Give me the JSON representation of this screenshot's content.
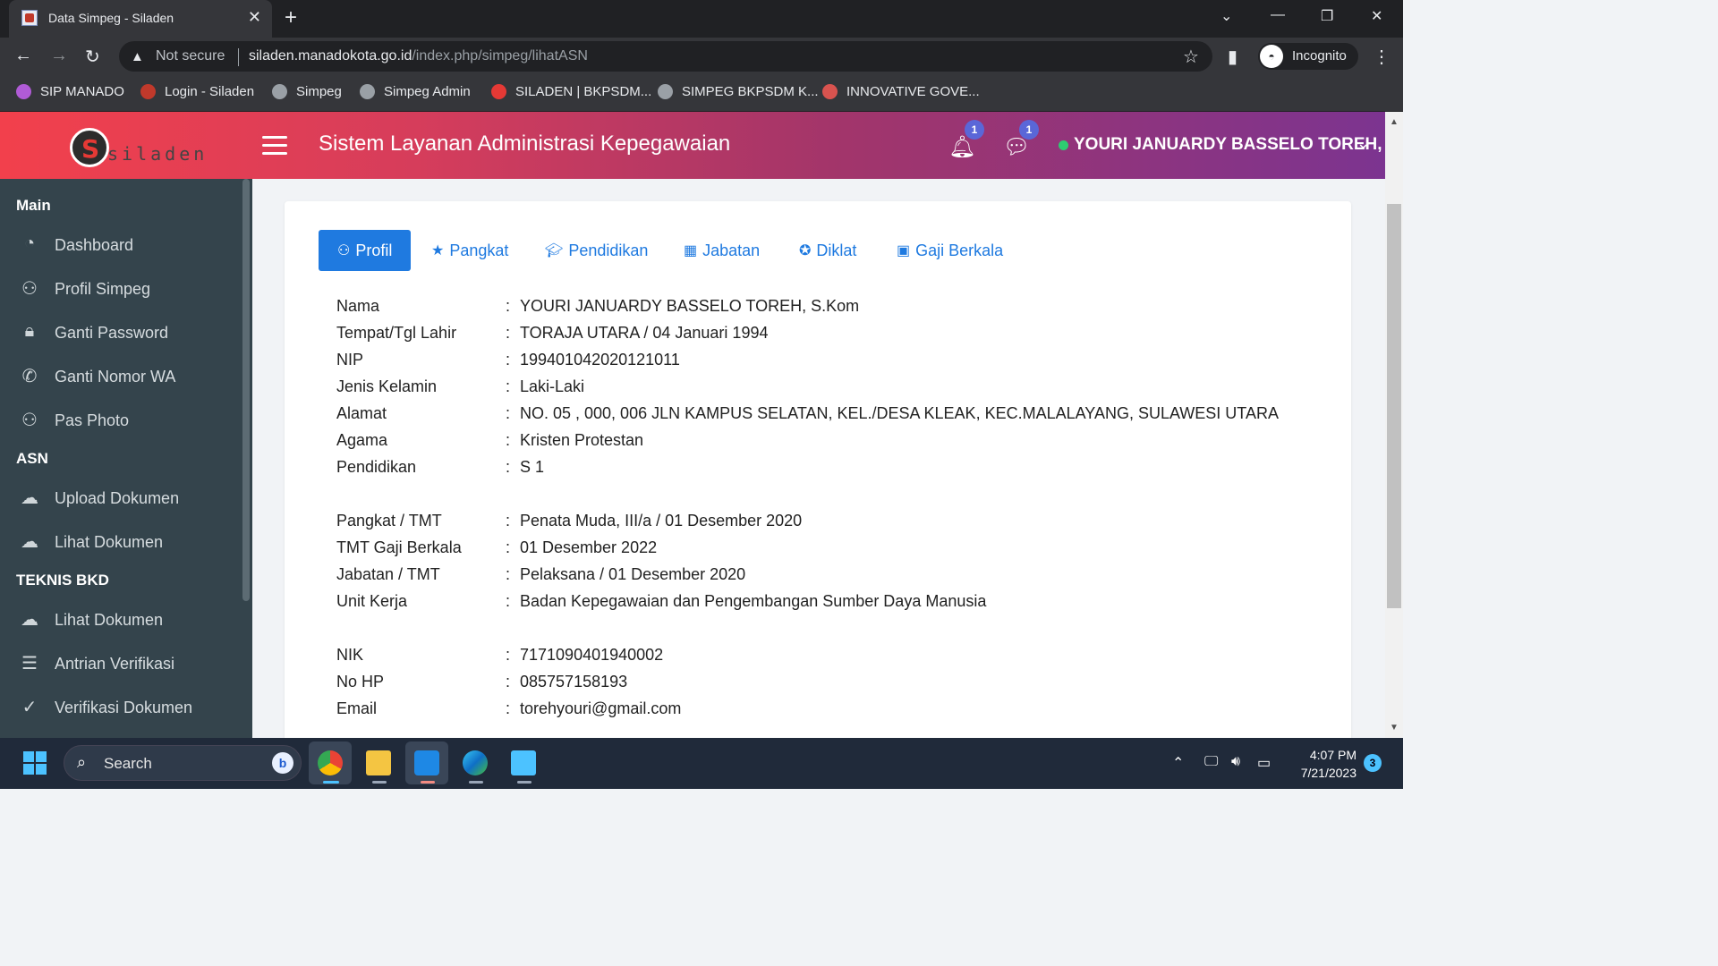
{
  "browser": {
    "tab_title": "Data Simpeg - Siladen",
    "tab_close": "✕",
    "new_tab": "+",
    "address_warning": "Not secure",
    "url_host": "siladen.manadokota.go.id",
    "url_path": "/index.php/simpeg/lihatASN",
    "profile_label": "Incognito",
    "bookmarks": [
      {
        "label": "SIP MANADO",
        "color": "#b05bd6"
      },
      {
        "label": "Login - Siladen",
        "color": "#c0392b"
      },
      {
        "label": "Simpeg",
        "color": "#9aa0a6"
      },
      {
        "label": "Simpeg Admin",
        "color": "#9aa0a6"
      },
      {
        "label": "SILADEN | BKPSDM...",
        "color": "#e53935"
      },
      {
        "label": "SIMPEG BKPSDM K...",
        "color": "#9aa0a6"
      },
      {
        "label": "INNOVATIVE GOVE...",
        "color": "#d9534f"
      }
    ]
  },
  "header": {
    "logo_text": "siladen",
    "title": "Sistem Layanan Administrasi Kepegawaian",
    "notif_count": "1",
    "message_count": "1",
    "user_name": "YOURI JANUARDY BASSELO TOREH,",
    "user_status_color": "#2ecc71"
  },
  "sidebar": {
    "sections": [
      {
        "title": "Main"
      },
      {
        "title": "ASN"
      },
      {
        "title": "TEKNIS BKD"
      }
    ],
    "items": [
      {
        "label": "Dashboard",
        "icon": "dashboard-icon"
      },
      {
        "label": "Profil Simpeg",
        "icon": "user-icon"
      },
      {
        "label": "Ganti Password",
        "icon": "lock-icon"
      },
      {
        "label": "Ganti Nomor WA",
        "icon": "whatsapp-icon"
      },
      {
        "label": "Pas Photo",
        "icon": "user-icon"
      },
      {
        "label": "Upload Dokumen",
        "icon": "cloud-upload-icon"
      },
      {
        "label": "Lihat Dokumen",
        "icon": "cloud-download-icon"
      },
      {
        "label": "Lihat Dokumen",
        "icon": "cloud-download-icon"
      },
      {
        "label": "Antrian Verifikasi",
        "icon": "server-icon"
      },
      {
        "label": "Verifikasi Dokumen",
        "icon": "check-circle-icon"
      }
    ]
  },
  "tabs": [
    {
      "label": "Profil",
      "icon": "user-icon",
      "active": true
    },
    {
      "label": "Pangkat",
      "icon": "star-icon"
    },
    {
      "label": "Pendidikan",
      "icon": "graduation-cap-icon"
    },
    {
      "label": "Jabatan",
      "icon": "table-icon"
    },
    {
      "label": "Diklat",
      "icon": "award-icon"
    },
    {
      "label": "Gaji Berkala",
      "icon": "money-icon"
    }
  ],
  "profile": [
    {
      "label": "Nama",
      "value": "YOURI JANUARDY BASSELO TOREH, S.Kom"
    },
    {
      "label": "Tempat/Tgl Lahir",
      "value": "TORAJA UTARA / 04 Januari 1994"
    },
    {
      "label": "NIP",
      "value": "199401042020121011"
    },
    {
      "label": "Jenis Kelamin",
      "value": "Laki-Laki"
    },
    {
      "label": "Alamat",
      "value": "NO. 05 , 000, 006 JLN KAMPUS SELATAN, KEL./DESA KLEAK, KEC.MALALAYANG, SULAWESI UTARA"
    },
    {
      "label": "Agama",
      "value": "Kristen Protestan"
    },
    {
      "label": "Pendidikan",
      "value": "S 1"
    },
    {
      "label": "Pangkat / TMT",
      "value": "Penata Muda, III/a / 01 Desember 2020"
    },
    {
      "label": "TMT Gaji Berkala",
      "value": "01 Desember 2022"
    },
    {
      "label": "Jabatan / TMT",
      "value": "Pelaksana / 01 Desember 2020"
    },
    {
      "label": "Unit Kerja",
      "value": "Badan Kepegawaian dan Pengembangan Sumber Daya Manusia"
    },
    {
      "label": "NIK",
      "value": "7171090401940002"
    },
    {
      "label": "No HP",
      "value": "085757158193"
    },
    {
      "label": "Email",
      "value": "torehyouri@gmail.com"
    }
  ],
  "colon": ":",
  "taskbar": {
    "search_label": "Search",
    "time": "4:07 PM",
    "date": "7/21/2023",
    "notification_count": "3"
  }
}
